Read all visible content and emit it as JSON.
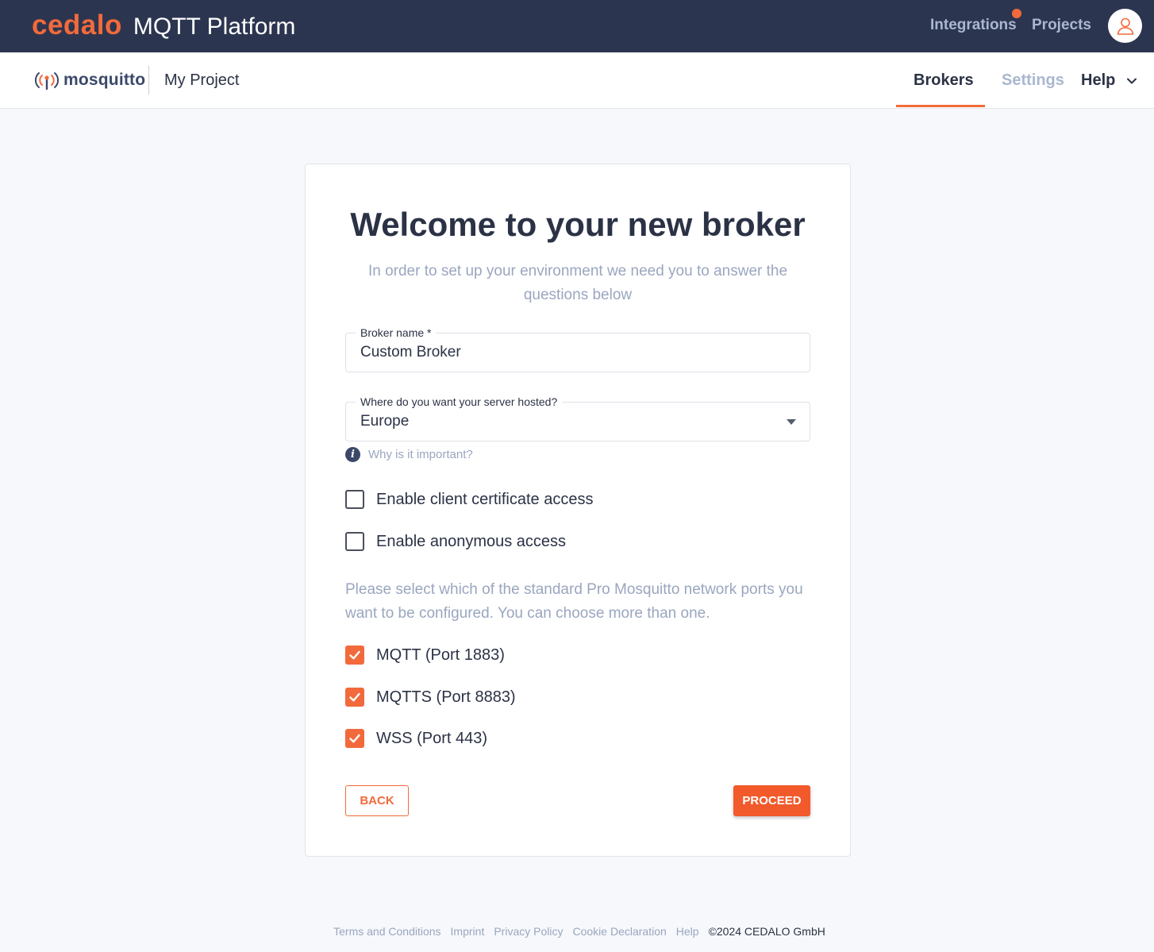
{
  "header": {
    "brand_logo": "cedalo",
    "app_title": "MQTT Platform",
    "integrations_label": "Integrations",
    "projects_label": "Projects",
    "avatar_icon": "user-icon",
    "accent_color": "#f26a3b"
  },
  "subnav": {
    "product_logo": "mosquitto",
    "project_name": "My Project",
    "tabs": [
      {
        "label": "Brokers",
        "active": true
      },
      {
        "label": "Settings",
        "active": false
      },
      {
        "label": "Help",
        "active": false
      }
    ]
  },
  "card": {
    "title": "Welcome to your new broker",
    "subtitle": "In order to set up your environment we need you to answer the questions below",
    "broker_name": {
      "label": "Broker name *",
      "value": "Custom Broker"
    },
    "region": {
      "label": "Where do you want your server hosted?",
      "value": "Europe"
    },
    "hint_text": "Why is it important?",
    "options": [
      {
        "label": "Enable client certificate access",
        "checked": false
      },
      {
        "label": "Enable anonymous access",
        "checked": false
      }
    ],
    "ports_text": "Please select which of the standard Pro Mosquitto network ports you want to be configured. You can choose more than one.",
    "ports": [
      {
        "label": "MQTT (Port 1883)",
        "checked": true
      },
      {
        "label": "MQTTS (Port 8883)",
        "checked": true
      },
      {
        "label": "WSS (Port 443)",
        "checked": true
      }
    ],
    "back_label": "BACK",
    "proceed_label": "PROCEED"
  },
  "footer": {
    "links": [
      "Terms and Conditions",
      "Imprint",
      "Privacy Policy",
      "Cookie Declaration",
      "Help"
    ],
    "copyright": "©2024 CEDALO GmbH"
  }
}
